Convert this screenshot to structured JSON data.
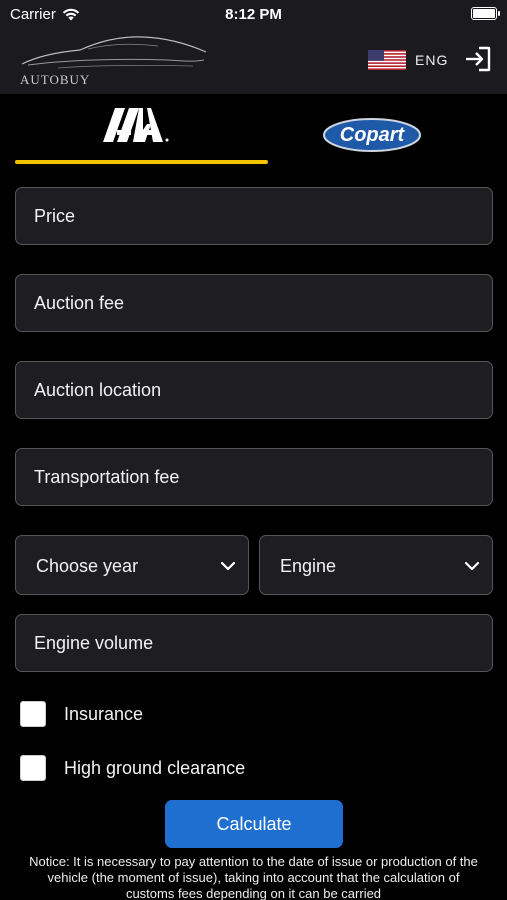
{
  "status": {
    "carrier": "Carrier",
    "time": "8:12 PM"
  },
  "header": {
    "logo_text": "AUTOBUY",
    "language": "ENG"
  },
  "tabs": {
    "iaa_label": "IAA",
    "copart_label": "Copart"
  },
  "form": {
    "price": "Price",
    "auction_fee": "Auction fee",
    "auction_location": "Auction location",
    "transportation_fee": "Transportation fee",
    "year_select": "Choose year",
    "engine_select": "Engine",
    "engine_volume": "Engine volume",
    "insurance": "Insurance",
    "high_clearance": "High ground clearance",
    "calculate": "Calculate"
  },
  "notice": "Notice: It is necessary to pay attention to the date of issue or production of the vehicle (the moment of issue), taking into account that the calculation of customs fees depending on it can be carried",
  "colors": {
    "accent_underline": "#f3c300",
    "button": "#1e6fd0",
    "field_bg": "#1e1e22"
  }
}
